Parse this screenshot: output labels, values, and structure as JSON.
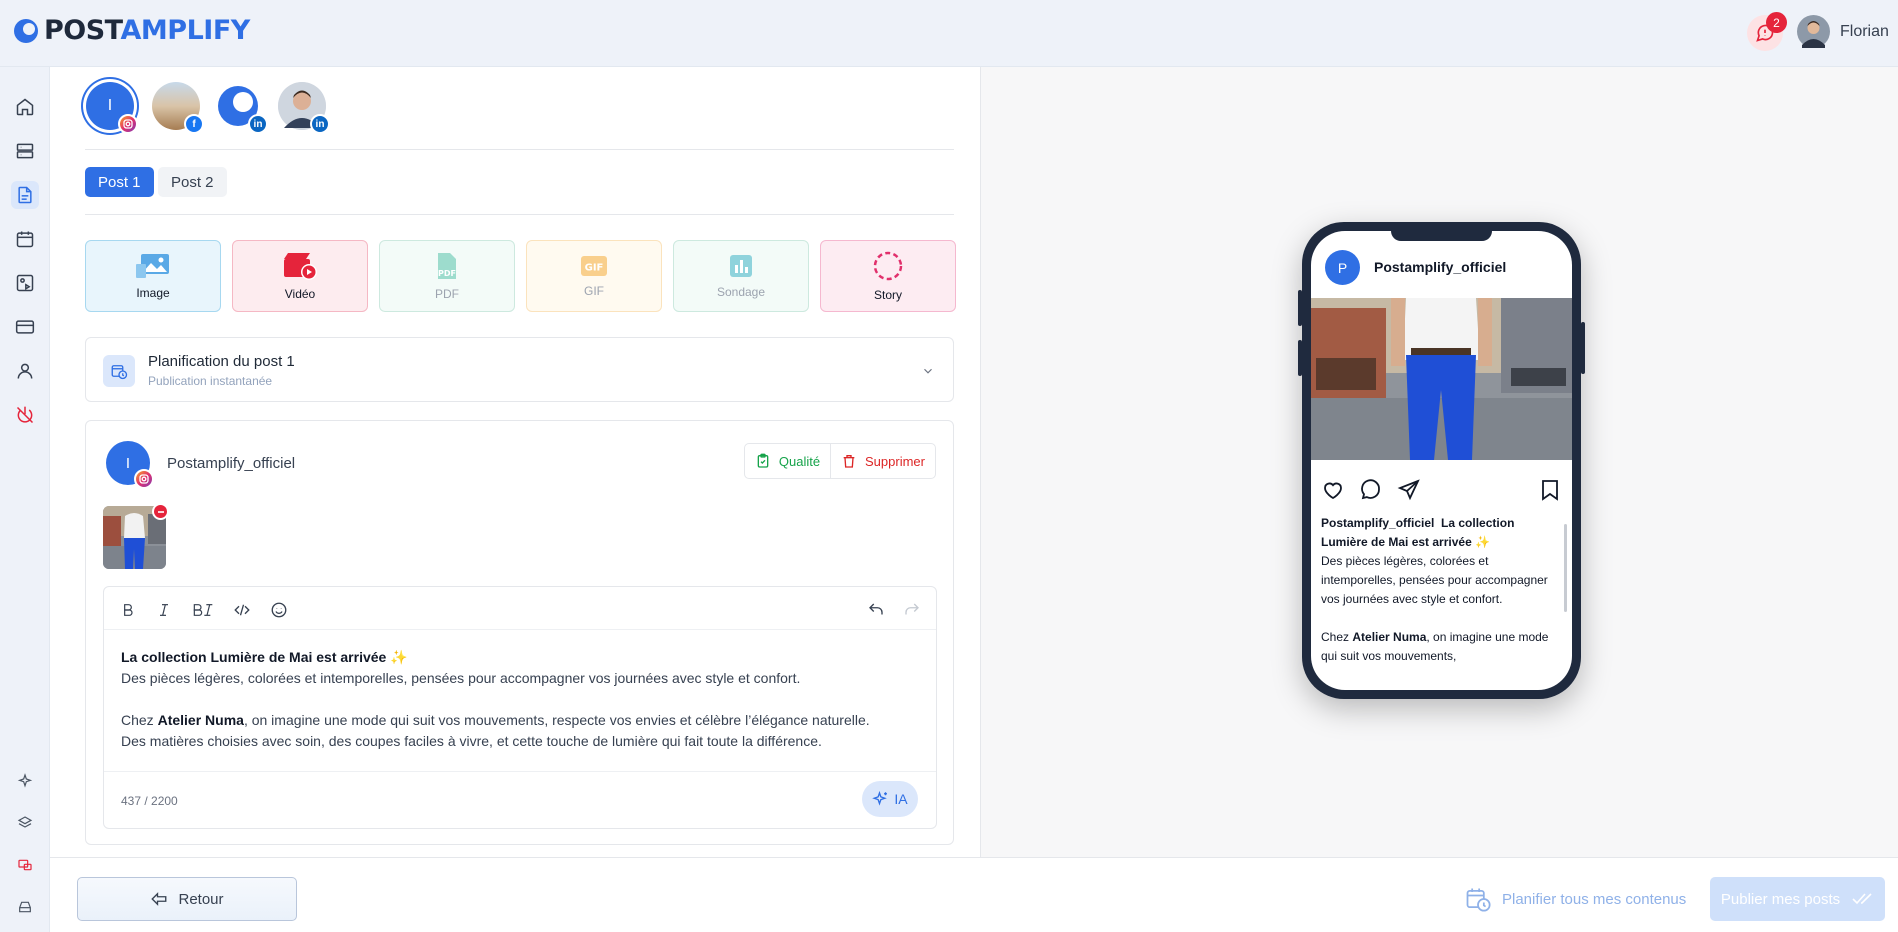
{
  "brand": {
    "logo_part1": "POST",
    "logo_part2": "AMPLIFY",
    "primary": "#2f6fe4"
  },
  "topbar": {
    "notification_count": "2",
    "user_name": "Florian"
  },
  "sidebar": {
    "items": [
      "home-icon",
      "server-icon",
      "document-icon",
      "calendar-icon",
      "media-icon",
      "card-icon",
      "user-icon",
      "power-icon",
      "sparkle-icon",
      "layers-icon",
      "bug-icon",
      "inbox-icon"
    ]
  },
  "accounts": [
    {
      "initial": "I",
      "network": "instagram"
    },
    {
      "initial": "",
      "network": "facebook"
    },
    {
      "initial": "",
      "network": "linkedin"
    },
    {
      "initial": "",
      "network": "linkedin"
    }
  ],
  "tabs": [
    {
      "label": "Post 1"
    },
    {
      "label": "Post 2"
    }
  ],
  "media_types": [
    {
      "label": "Image"
    },
    {
      "label": "Vidéo"
    },
    {
      "label": "PDF"
    },
    {
      "label": "GIF"
    },
    {
      "label": "Sondage"
    },
    {
      "label": "Story"
    }
  ],
  "schedule": {
    "title": "Planification du post 1",
    "subtitle": "Publication instantanée"
  },
  "post": {
    "account_initial": "I",
    "account_name": "Postamplify_officiel",
    "quality_label": "Qualité",
    "delete_label": "Supprimer",
    "line1_bold": "La collection Lumière de Mai est arrivée",
    "line1_emoji": "✨",
    "line2": "Des pièces légères, colorées et intemporelles, pensées pour accompagner vos journées avec style et confort.",
    "line3_a": "Chez ",
    "line3_bold": "Atelier Numa",
    "line3_b": ", on imagine une mode qui suit vos mouvements, respecte vos envies et célèbre l’élégance naturelle.",
    "line4": "Des matières choisies avec soin, des coupes faciles à vivre, et cette touche de lumière qui fait toute la différence.",
    "counter": "437 / 2200",
    "ai_label": "IA"
  },
  "preview": {
    "avatar_initial": "P",
    "username": "Postamplify_officiel",
    "cap_bold1": "La collection",
    "cap_bold2": "Lumière de Mai est arrivée",
    "cap_emoji": "✨",
    "cap_line2": "Des pièces légères, colorées et intemporelles, pensées pour accompagner vos journées avec style et confort.",
    "cap_chez": "Chez ",
    "cap_atelier": "Atelier Numa",
    "cap_rest": ", on imagine une mode qui suit vos mouvements,"
  },
  "footer": {
    "back_label": "Retour",
    "schedule_all_label": "Planifier tous mes contenus",
    "publish_label": "Publier mes posts"
  }
}
